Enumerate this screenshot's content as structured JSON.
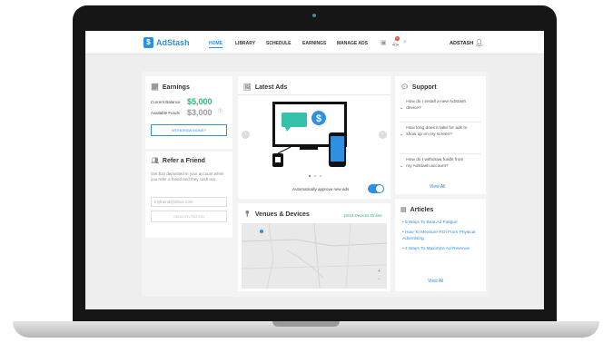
{
  "brand": {
    "logo_badge": "$",
    "name": "AdStash"
  },
  "nav": {
    "links": [
      "HOME",
      "LIBRARY",
      "SCHEDULE",
      "EARNINGS",
      "MANAGE ADS"
    ],
    "notification_count": "0",
    "username": "ADSTASH"
  },
  "earnings": {
    "title": "Earnings",
    "current_balance_label": "Current Balance",
    "current_balance_value": "$5,000",
    "available_funds_label": "Available Funds",
    "available_funds_value": "$3,000",
    "withdraw_label": "WITHDRAW MONEY"
  },
  "refer": {
    "title": "Refer a Friend",
    "description": "Get $10 deposited in your account when you refer a friend and they cash out.",
    "email_placeholder": "myfriend@inbox.com",
    "send_label": "SEND INVITATION"
  },
  "latest_ads": {
    "title": "Latest Ads",
    "screen_text": "ADS",
    "auto_approve_label": "Automatically approve new ads",
    "auto_approve_on": true
  },
  "support": {
    "title": "Support",
    "questions": [
      "How do I install a new AdStash device?",
      "How long does it take for ads to show up on my screen?",
      "How do I withdraw funds from my AdStash account?"
    ],
    "view_all": "View All"
  },
  "venues": {
    "title": "Venues & Devices",
    "status": "10/10 Devices Online"
  },
  "articles": {
    "title": "Articles",
    "items": [
      "5 Ways To Beat Ad Fatigue",
      "How To Measure ROI From Physical Advertising",
      "4 Ways To Maximize Ad Revenue"
    ],
    "view_all": "View All"
  },
  "colors": {
    "accent": "#2f8fe0",
    "money_green": "#2bb673",
    "teal": "#34c0a9"
  },
  "icons": [
    "chart-icon",
    "friends-icon",
    "image-icon",
    "chat-icon",
    "pin-icon",
    "articles-icon",
    "user-icon",
    "bell-icon",
    "search-icon"
  ]
}
